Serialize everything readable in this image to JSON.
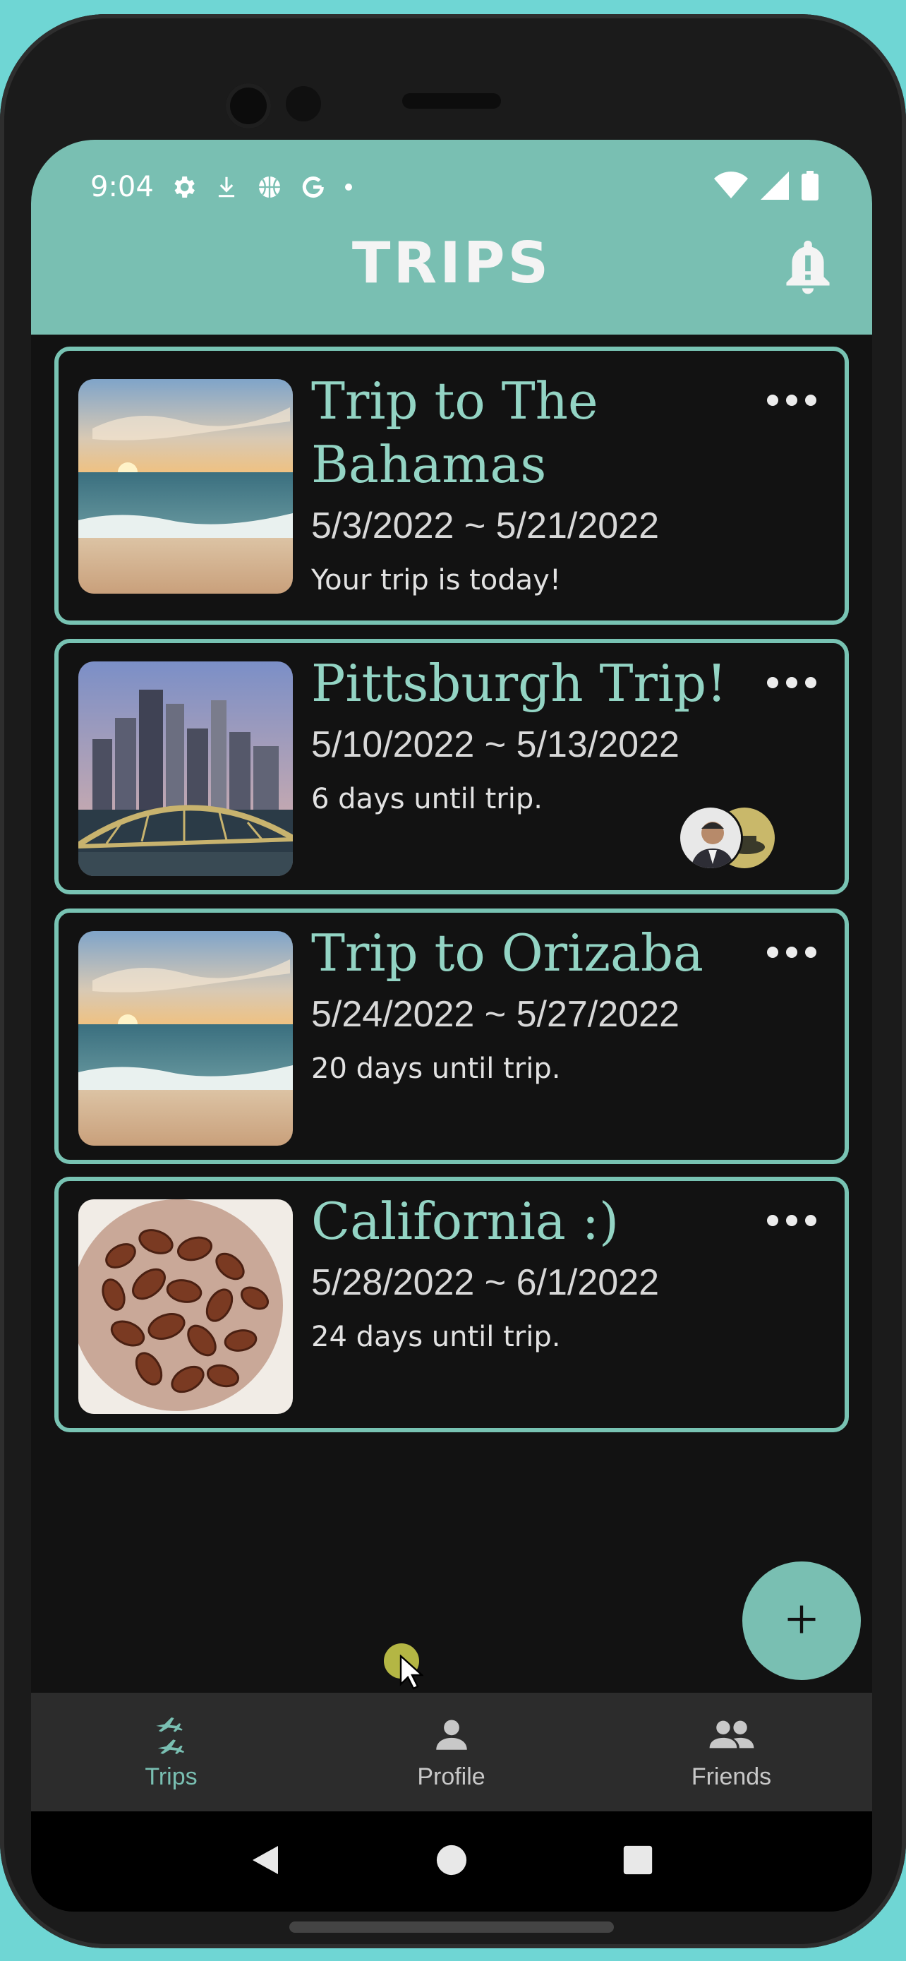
{
  "status_bar": {
    "time": "9:04"
  },
  "header": {
    "title": "TRIPS"
  },
  "trips": [
    {
      "title": "Trip to The Bahamas",
      "dates": "5/3/2022 ~ 5/21/2022",
      "status": "Your trip is today!"
    },
    {
      "title": "Pittsburgh Trip!",
      "dates": "5/10/2022 ~ 5/13/2022",
      "status": "6 days until trip."
    },
    {
      "title": "Trip to Orizaba",
      "dates": "5/24/2022 ~ 5/27/2022",
      "status": "20 days until trip."
    },
    {
      "title": "California :)",
      "dates": "5/28/2022 ~ 6/1/2022",
      "status": "24 days until trip."
    }
  ],
  "fab": {
    "icon": "plus-icon"
  },
  "bottom_nav": {
    "items": [
      {
        "label": "Trips",
        "icon": "plane-arrows-icon",
        "active": true
      },
      {
        "label": "Profile",
        "icon": "person-icon",
        "active": false
      },
      {
        "label": "Friends",
        "icon": "people-icon",
        "active": false
      }
    ]
  },
  "colors": {
    "accent": "#79bfb2",
    "title": "#93d4c4",
    "background": "#121212",
    "nav_active": "#79bfb2",
    "nav_inactive": "#c8c8c8"
  }
}
